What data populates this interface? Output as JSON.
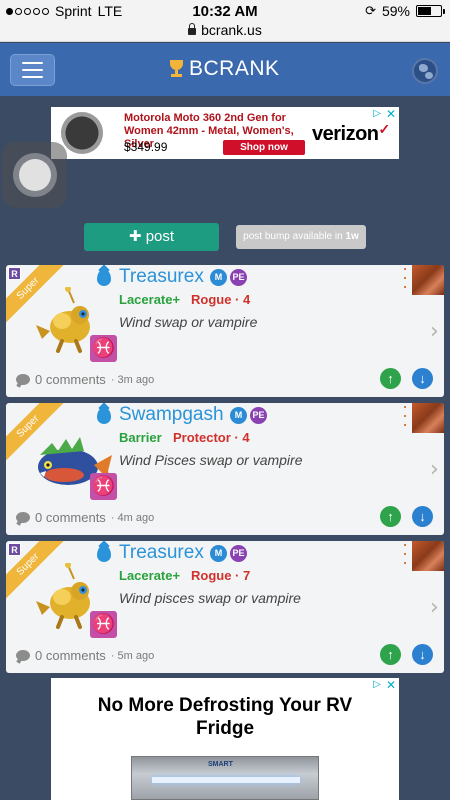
{
  "status_bar": {
    "carrier": "Sprint",
    "network": "LTE",
    "time": "10:32 AM",
    "battery": "59%",
    "battery_level": 0.59,
    "signal_bars_filled": 1,
    "signal_bars_total": 5
  },
  "url_bar": {
    "url": "bcrank.us"
  },
  "nav": {
    "brand": "BCRANK"
  },
  "ad_top": {
    "title": "Motorola Moto 360 2nd Gen for Women 42mm - Metal, Women's, Silver",
    "price": "$349.99",
    "cta": "Shop now",
    "brand": "verizon",
    "brand_mark": "✓"
  },
  "actions": {
    "post_label": "post",
    "bump_text": "post bump available in",
    "bump_time": "1w"
  },
  "posts": [
    {
      "ribbon": "Super",
      "rank": "R",
      "name": "Treasurex",
      "tag1": "M",
      "tag2": "PE",
      "skill": "Lacerate+",
      "role": "Rogue · 4",
      "description": "Wind swap or vampire",
      "comments": "0 comments",
      "ago": "· 3m ago",
      "sign": "♓"
    },
    {
      "ribbon": "Super",
      "rank": "",
      "name": "Swampgash",
      "tag1": "M",
      "tag2": "PE",
      "skill": "Barrier",
      "role": "Protector · 4",
      "description": "Wind Pisces swap or vampire",
      "comments": "0 comments",
      "ago": "· 4m ago",
      "sign": "♓"
    },
    {
      "ribbon": "Super",
      "rank": "R",
      "name": "Treasurex",
      "tag1": "M",
      "tag2": "PE",
      "skill": "Lacerate+",
      "role": "Rogue · 7",
      "description": "Wind pisces swap or vampire",
      "comments": "0 comments",
      "ago": "· 5m ago",
      "sign": "♓"
    }
  ],
  "ad_bottom": {
    "headline": "No More Defrosting Your RV Fridge",
    "product_label": "SMART"
  },
  "colors": {
    "background": "#3b4b63",
    "nav": "#3b69ad",
    "post_button": "#1e9c81",
    "name_blue": "#2b93d9",
    "skill_green": "#29a23d",
    "role_red": "#d0312d",
    "ribbon_gold": "#f0b63c"
  }
}
